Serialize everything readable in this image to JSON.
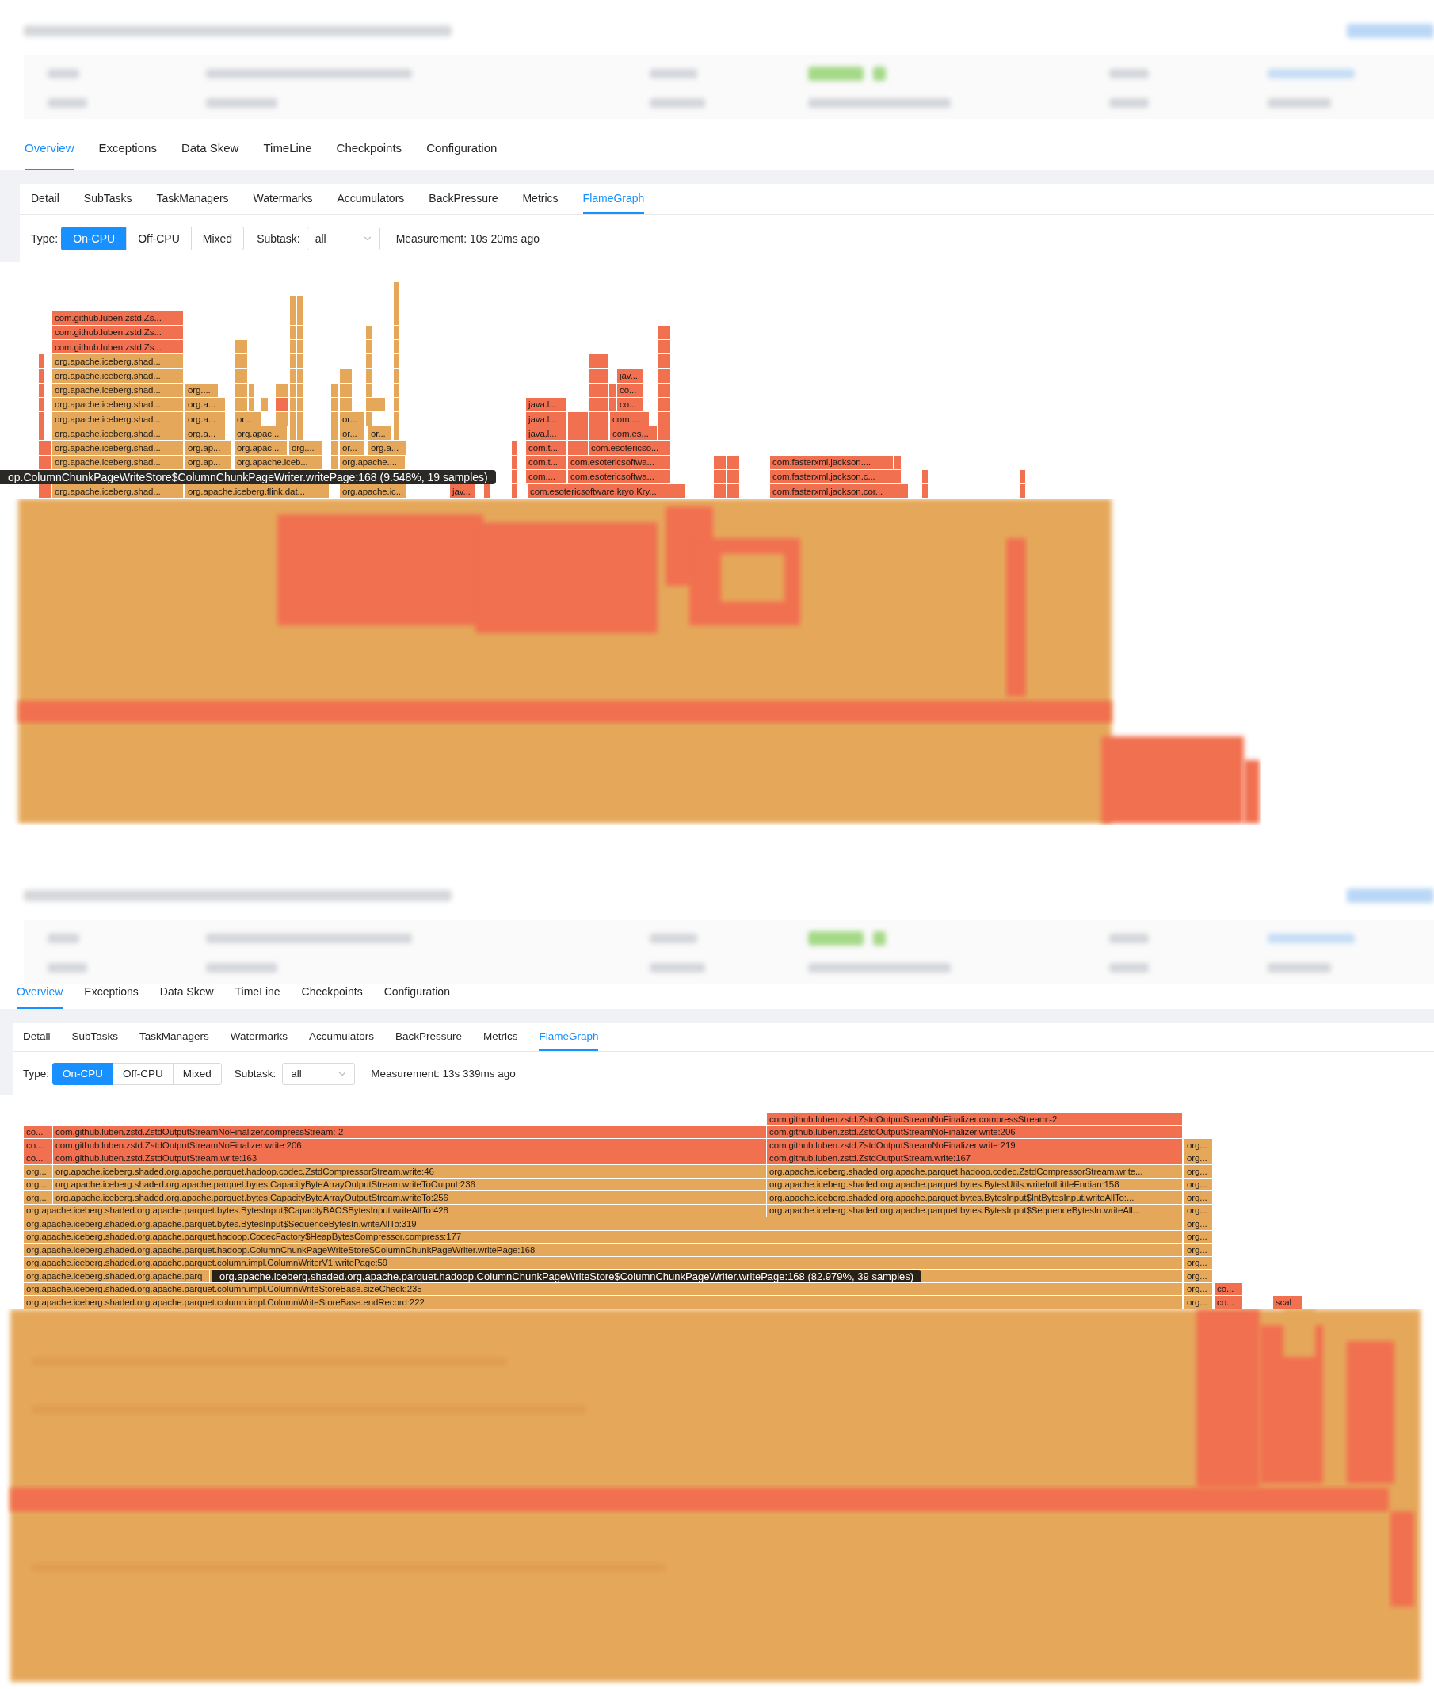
{
  "panels": [
    {
      "tabs": [
        {
          "label": "Overview",
          "selected": true
        },
        {
          "label": "Exceptions",
          "selected": false
        },
        {
          "label": "Data Skew",
          "selected": false
        },
        {
          "label": "TimeLine",
          "selected": false
        },
        {
          "label": "Checkpoints",
          "selected": false
        },
        {
          "label": "Configuration",
          "selected": false
        }
      ],
      "subtabs": [
        {
          "label": "Detail",
          "selected": false
        },
        {
          "label": "SubTasks",
          "selected": false
        },
        {
          "label": "TaskManagers",
          "selected": false
        },
        {
          "label": "Watermarks",
          "selected": false
        },
        {
          "label": "Accumulators",
          "selected": false
        },
        {
          "label": "BackPressure",
          "selected": false
        },
        {
          "label": "Metrics",
          "selected": false
        },
        {
          "label": "FlameGraph",
          "selected": true
        }
      ],
      "type_label": "Type:",
      "type_options": [
        {
          "label": "On-CPU",
          "selected": true
        },
        {
          "label": "Off-CPU",
          "selected": false
        },
        {
          "label": "Mixed",
          "selected": false
        }
      ],
      "subtask_label": "Subtask:",
      "subtask": {
        "value": "all"
      },
      "measurement": "Measurement: 10s 20ms ago",
      "frames": [
        {
          "label": "com.github.luben.zstd.Zs...",
          "color": "#f1704f"
        },
        {
          "label": "com.github.luben.zstd.Zs...",
          "color": "#f1704f"
        },
        {
          "label": "com.github.luben.zstd.Zs...",
          "color": "#f1704f"
        },
        {
          "label": "org.apache.iceberg.shad...",
          "color": "#e5a85a"
        },
        {
          "label": "org.apache.iceberg.shad...",
          "color": "#e5a85a"
        },
        {
          "label": "jav...",
          "color": "#f1704f"
        },
        {
          "label": "org.apache.iceberg.shad...",
          "color": "#e5a85a"
        },
        {
          "label": "org....",
          "color": "#e5a85a"
        },
        {
          "label": "co...",
          "color": "#f1704f"
        },
        {
          "label": "org.apache.iceberg.shad...",
          "color": "#e5a85a"
        },
        {
          "label": "org.a...",
          "color": "#e5a85a"
        },
        {
          "label": "java.l...",
          "color": "#f1704f"
        },
        {
          "label": "co...",
          "color": "#f1704f"
        },
        {
          "label": "org.apache.iceberg.shad...",
          "color": "#e5a85a"
        },
        {
          "label": "org.a...",
          "color": "#e5a85a"
        },
        {
          "label": "or...",
          "color": "#e5a85a"
        },
        {
          "label": "or...",
          "color": "#e5a85a"
        },
        {
          "label": "java.l...",
          "color": "#f1704f"
        },
        {
          "label": "com....",
          "color": "#f1704f"
        },
        {
          "label": "org.apache.iceberg.shad...",
          "color": "#e5a85a"
        },
        {
          "label": "org.a...",
          "color": "#e5a85a"
        },
        {
          "label": "org.apac...",
          "color": "#e5a85a"
        },
        {
          "label": "or...",
          "color": "#e5a85a"
        },
        {
          "label": "or...",
          "color": "#e5a85a"
        },
        {
          "label": "java.l...",
          "color": "#f1704f"
        },
        {
          "label": "com.es...",
          "color": "#f1704f"
        },
        {
          "label": "org.apache.iceberg.shad...",
          "color": "#e5a85a"
        },
        {
          "label": "org.ap...",
          "color": "#e5a85a"
        },
        {
          "label": "org.apac...",
          "color": "#e5a85a"
        },
        {
          "label": "org....",
          "color": "#e5a85a"
        },
        {
          "label": "or...",
          "color": "#e5a85a"
        },
        {
          "label": "org.a...",
          "color": "#e5a85a"
        },
        {
          "label": "com.t...",
          "color": "#f1704f"
        },
        {
          "label": "com.esotericso...",
          "color": "#f1704f"
        },
        {
          "label": "org.apache.iceberg.shad...",
          "color": "#e5a85a"
        },
        {
          "label": "org.ap...",
          "color": "#e5a85a"
        },
        {
          "label": "org.apache.iceb...",
          "color": "#e5a85a"
        },
        {
          "label": "org.apache....",
          "color": "#e5a85a"
        },
        {
          "label": "com.t...",
          "color": "#f1704f"
        },
        {
          "label": "com.esotericsoftwa...",
          "color": "#f1704f"
        },
        {
          "label": "com.fasterxml.jackson....",
          "color": "#f1704f"
        },
        {
          "label": "com....",
          "color": "#f1704f"
        },
        {
          "label": "com.esotericsoftwa...",
          "color": "#f1704f"
        },
        {
          "label": "com.fasterxml.jackson.c...",
          "color": "#f1704f"
        },
        {
          "label": "org.apache.iceberg.shad...",
          "color": "#e5a85a"
        },
        {
          "label": "org.apache.iceberg.flink.dat...",
          "color": "#e5a85a"
        },
        {
          "label": "org.apache.ic...",
          "color": "#e5a85a"
        },
        {
          "label": "jav...",
          "color": "#f1704f"
        },
        {
          "label": "com.esotericsoftware.kryo.Kry...",
          "color": "#f1704f"
        },
        {
          "label": "com.fasterxml.jackson.cor...",
          "color": "#f1704f"
        }
      ],
      "tooltip": "op.ColumnChunkPageWriteStore$ColumnChunkPageWriter.writePage:168 (9.548%, 19 samples)"
    },
    {
      "tabs": [
        {
          "label": "Overview",
          "selected": true
        },
        {
          "label": "Exceptions",
          "selected": false
        },
        {
          "label": "Data Skew",
          "selected": false
        },
        {
          "label": "TimeLine",
          "selected": false
        },
        {
          "label": "Checkpoints",
          "selected": false
        },
        {
          "label": "Configuration",
          "selected": false
        }
      ],
      "subtabs": [
        {
          "label": "Detail",
          "selected": false
        },
        {
          "label": "SubTasks",
          "selected": false
        },
        {
          "label": "TaskManagers",
          "selected": false
        },
        {
          "label": "Watermarks",
          "selected": false
        },
        {
          "label": "Accumulators",
          "selected": false
        },
        {
          "label": "BackPressure",
          "selected": false
        },
        {
          "label": "Metrics",
          "selected": false
        },
        {
          "label": "FlameGraph",
          "selected": true
        }
      ],
      "type_label": "Type:",
      "type_options": [
        {
          "label": "On-CPU",
          "selected": true
        },
        {
          "label": "Off-CPU",
          "selected": false
        },
        {
          "label": "Mixed",
          "selected": false
        }
      ],
      "subtask_label": "Subtask:",
      "subtask": {
        "value": "all"
      },
      "measurement": "Measurement: 13s 339ms ago",
      "frames": [
        {
          "label": "com.github.luben.zstd.ZstdOutputStreamNoFinalizer.compressStream:-2",
          "color": "#f1704f"
        },
        {
          "label": "co...",
          "color": "#f1704f"
        },
        {
          "label": "com.github.luben.zstd.ZstdOutputStreamNoFinalizer.compressStream:-2",
          "color": "#f1704f"
        },
        {
          "label": "com.github.luben.zstd.ZstdOutputStreamNoFinalizer.write:206",
          "color": "#f1704f"
        },
        {
          "label": "co...",
          "color": "#f1704f"
        },
        {
          "label": "com.github.luben.zstd.ZstdOutputStreamNoFinalizer.write:206",
          "color": "#f1704f"
        },
        {
          "label": "com.github.luben.zstd.ZstdOutputStreamNoFinalizer.write:219",
          "color": "#f1704f"
        },
        {
          "label": "org...",
          "color": "#e5a85a"
        },
        {
          "label": "co...",
          "color": "#f1704f"
        },
        {
          "label": "com.github.luben.zstd.ZstdOutputStream.write:163",
          "color": "#f1704f"
        },
        {
          "label": "com.github.luben.zstd.ZstdOutputStream.write:167",
          "color": "#f1704f"
        },
        {
          "label": "org...",
          "color": "#e5a85a"
        },
        {
          "label": "org...",
          "color": "#e5a85a"
        },
        {
          "label": "org.apache.iceberg.shaded.org.apache.parquet.hadoop.codec.ZstdCompressorStream.write:46",
          "color": "#e5a85a"
        },
        {
          "label": "org.apache.iceberg.shaded.org.apache.parquet.hadoop.codec.ZstdCompressorStream.write...",
          "color": "#e5a85a"
        },
        {
          "label": "org...",
          "color": "#e5a85a"
        },
        {
          "label": "org...",
          "color": "#e5a85a"
        },
        {
          "label": "org.apache.iceberg.shaded.org.apache.parquet.bytes.CapacityByteArrayOutputStream.writeToOutput:236",
          "color": "#e5a85a"
        },
        {
          "label": "org.apache.iceberg.shaded.org.apache.parquet.bytes.BytesUtils.writeIntLittleEndian:158",
          "color": "#e5a85a"
        },
        {
          "label": "org...",
          "color": "#e5a85a"
        },
        {
          "label": "org...",
          "color": "#e5a85a"
        },
        {
          "label": "org.apache.iceberg.shaded.org.apache.parquet.bytes.CapacityByteArrayOutputStream.writeTo:256",
          "color": "#e5a85a"
        },
        {
          "label": "org.apache.iceberg.shaded.org.apache.parquet.bytes.BytesInput$IntBytesInput.writeAllTo:...",
          "color": "#e5a85a"
        },
        {
          "label": "org...",
          "color": "#e5a85a"
        },
        {
          "label": "org.apache.iceberg.shaded.org.apache.parquet.bytes.BytesInput$CapacityBAOSBytesInput.writeAllTo:428",
          "color": "#e5a85a"
        },
        {
          "label": "org.apache.iceberg.shaded.org.apache.parquet.bytes.BytesInput$SequenceBytesIn.writeAll...",
          "color": "#e5a85a"
        },
        {
          "label": "org...",
          "color": "#e5a85a"
        },
        {
          "label": "org.apache.iceberg.shaded.org.apache.parquet.bytes.BytesInput$SequenceBytesIn.writeAllTo:319",
          "color": "#e5a85a"
        },
        {
          "label": "org...",
          "color": "#e5a85a"
        },
        {
          "label": "org.apache.iceberg.shaded.org.apache.parquet.hadoop.CodecFactory$HeapBytesCompressor.compress:177",
          "color": "#e5a85a"
        },
        {
          "label": "org...",
          "color": "#e5a85a"
        },
        {
          "label": "org.apache.iceberg.shaded.org.apache.parquet.hadoop.ColumnChunkPageWriteStore$ColumnChunkPageWriter.writePage:168",
          "color": "#e5a85a"
        },
        {
          "label": "org...",
          "color": "#e5a85a"
        },
        {
          "label": "org.apache.iceberg.shaded.org.apache.parquet.column.impl.ColumnWriterV1.writePage:59",
          "color": "#e5a85a"
        },
        {
          "label": "org...",
          "color": "#e5a85a"
        },
        {
          "label": "org.apache.iceberg.shaded.org.apache.parq",
          "color": "#e5a85a"
        },
        {
          "label": "org...",
          "color": "#e5a85a"
        },
        {
          "label": "org.apache.iceberg.shaded.org.apache.parquet.column.impl.ColumnWriteStoreBase.sizeCheck:235",
          "color": "#e5a85a"
        },
        {
          "label": "org...",
          "color": "#e5a85a"
        },
        {
          "label": "co...",
          "color": "#f1704f"
        },
        {
          "label": "org.apache.iceberg.shaded.org.apache.parquet.column.impl.ColumnWriteStoreBase.endRecord:222",
          "color": "#e5a85a"
        },
        {
          "label": "org...",
          "color": "#e5a85a"
        },
        {
          "label": "co...",
          "color": "#f1704f"
        },
        {
          "label": "scal",
          "color": "#f1704f"
        }
      ],
      "tooltip": "org.apache.iceberg.shaded.org.apache.parquet.hadoop.ColumnChunkPageWriteStore$ColumnChunkPageWriter.writePage:168 (82.979%, 39 samples)"
    }
  ]
}
